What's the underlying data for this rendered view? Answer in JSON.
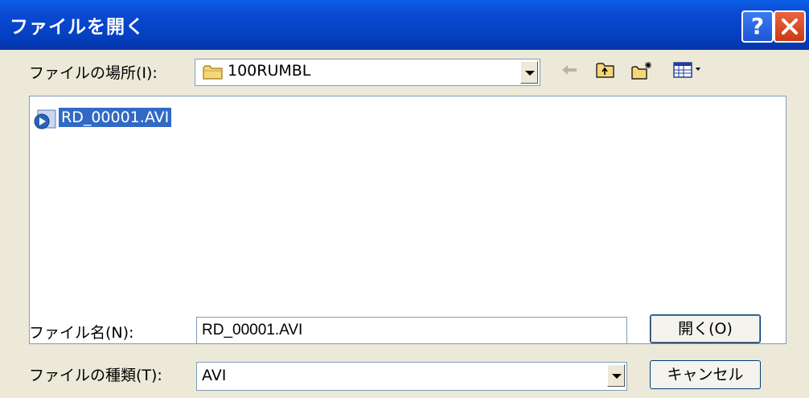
{
  "window": {
    "title": "ファイルを開く",
    "help_label": "?"
  },
  "location": {
    "label": "ファイルの場所(I):",
    "value": "100RUMBL"
  },
  "files": [
    {
      "name": "RD_00001.AVI"
    }
  ],
  "filename": {
    "label": "ファイル名(N):",
    "value": "RD_00001.AVI"
  },
  "filetype": {
    "label": "ファイルの種類(T):",
    "value": "AVI"
  },
  "buttons": {
    "open": "開く(O)",
    "cancel": "キャンセル"
  },
  "toolbar_icons": [
    "back-arrow-icon",
    "up-folder-icon",
    "new-folder-icon",
    "view-menu-icon"
  ]
}
